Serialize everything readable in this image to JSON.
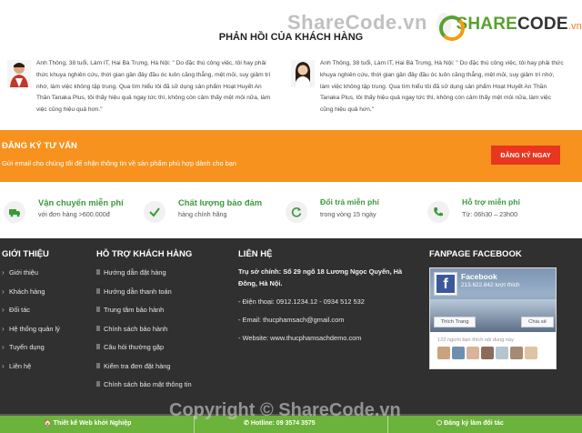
{
  "watermark": {
    "top": "ShareCode.vn",
    "bottom": "Copyright © ShareCode.vn"
  },
  "logo": {
    "share": "SHARE",
    "code": "CODE",
    "tld": ".vn"
  },
  "feedback": {
    "title": "PHẢN HỒI CỦA KHÁCH HÀNG",
    "items": [
      {
        "text": "Anh Thông, 38 tuổi, Làm IT, Hai Bà Trưng, Hà Nội: \" Do đặc thù công việc, tôi hay phải thức khuya nghiên cứu, thời gian gần đây đầu óc luôn căng thẳng, mệt mỏi, suy giảm trí nhớ, làm việc không tập trung. Qua tìm hiểu tôi đã sử dụng sản phẩm Hoạt Huyết An Thần Tanaka Plus, tôi thấy hiệu quả ngay tức thì, không còn cảm thấy mệt mỏi nữa, làm việc cũng hiệu quả hơn.\""
      },
      {
        "text": "Anh Thông, 38 tuổi, Làm IT, Hai Bà Trưng, Hà Nội: \" Do đặc thù công việc, tôi hay phải thức khuya nghiên cứu, thời gian gần đây đầu óc luôn căng thẳng, mệt mỏi, suy giảm trí nhớ, làm việc không tập trung. Qua tìm hiểu tôi đã sử dụng sản phẩm Hoạt Huyết An Thần Tanaka Plus, tôi thấy hiệu quả ngay tức thì, không còn cảm thấy mệt mỏi nữa, làm việc cũng hiệu quả hơn.\""
      }
    ]
  },
  "consult": {
    "title": "ĐĂNG KÝ TƯ VẤN",
    "subtitle": "Gửi email cho chúng tôi để nhận thông tin về sản phẩm phù hợp dành cho bạn",
    "button": "ĐĂNG KÝ NGAY",
    "color": "#f7921e"
  },
  "features": [
    {
      "icon": "truck-icon",
      "title": "Vận chuyển miễn phí",
      "desc": "với đơn hàng >600.000đ"
    },
    {
      "icon": "check-icon",
      "title": "Chất lượng bảo đảm",
      "desc": "hàng chính hãng"
    },
    {
      "icon": "refresh-icon",
      "title": "Đổi trả miễn phí",
      "desc": "trong vòng 15 ngày"
    },
    {
      "icon": "phone-icon",
      "title": "Hỗ trợ miễn phí",
      "desc": "Từ: 06h30 – 23h00"
    }
  ],
  "footer": {
    "intro": {
      "title": "GIỚI THIỆU",
      "links": [
        "Giới thiệu",
        "Khách hàng",
        "Đối tác",
        "Hệ thống quản lý",
        "Tuyển dụng",
        "Liên hệ"
      ]
    },
    "support": {
      "title": "HỖ TRỢ KHÁCH HÀNG",
      "links": [
        "Hướng dẫn đặt hàng",
        "Hướng dẫn thanh toán",
        "Trung tâm bảo hành",
        "Chính sách bảo hành",
        "Câu hỏi thường gặp",
        "Kiểm tra đơn đặt hàng",
        "Chính sách bảo mật thông tin"
      ]
    },
    "contact": {
      "title": "LIÊN HỆ",
      "address": "Trụ sở chính: Số 29 ngõ 18 Lương Ngọc Quyến, Hà Đông, Hà Nội.",
      "phone": "- Điện thoại: 0912.1234.12 - 0934 512 532",
      "email": "- Email: thucphamsach@gmail.com",
      "website": "- Website: www.thucphamsachdemo.com"
    },
    "fanpage": {
      "title": "FANPAGE FACEBOOK",
      "page_name": "Facebook",
      "likes": "213.622.842 lượt thích",
      "like_btn": "Thích Trang",
      "share_btn": "Chia sẻ",
      "friends": "122 người bạn thích nội dung này"
    }
  },
  "bottom_bar": {
    "left": "Thiết kế Web khởi Nghiệp",
    "middle": "Hotline: 09 3574 3575",
    "right": "Đăng ký làm đối tác",
    "color": "#6bb33a"
  }
}
